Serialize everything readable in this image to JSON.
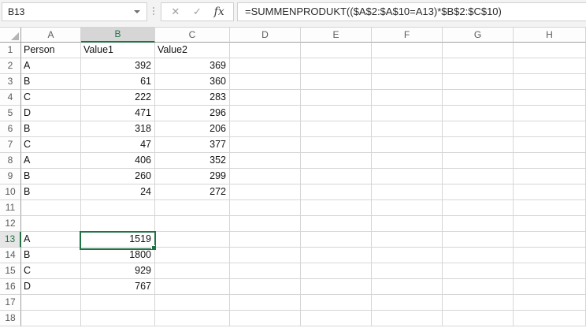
{
  "name_box": {
    "value": "B13"
  },
  "formula_bar": {
    "cancel_icon": "✕",
    "enter_icon": "✓",
    "insert_function_icon": "fx",
    "formula": "=SUMMENPRODUKT(($A$2:$A$10=A13)*$B$2:$C$10)"
  },
  "selection": {
    "active_cell": "B13",
    "column": "B",
    "row": 13,
    "accent_color": "#217346"
  },
  "sheet": {
    "column_headers": [
      "A",
      "B",
      "C",
      "D",
      "E",
      "F",
      "G",
      "H"
    ],
    "rows": [
      {
        "n": 1,
        "A": "Person",
        "B": "Value1",
        "C": "Value2"
      },
      {
        "n": 2,
        "A": "A",
        "B": 392,
        "C": 369
      },
      {
        "n": 3,
        "A": "B",
        "B": 61,
        "C": 360
      },
      {
        "n": 4,
        "A": "C",
        "B": 222,
        "C": 283
      },
      {
        "n": 5,
        "A": "D",
        "B": 471,
        "C": 296
      },
      {
        "n": 6,
        "A": "B",
        "B": 318,
        "C": 206
      },
      {
        "n": 7,
        "A": "C",
        "B": 47,
        "C": 377
      },
      {
        "n": 8,
        "A": "A",
        "B": 406,
        "C": 352
      },
      {
        "n": 9,
        "A": "B",
        "B": 260,
        "C": 299
      },
      {
        "n": 10,
        "A": "B",
        "B": 24,
        "C": 272
      },
      {
        "n": 11
      },
      {
        "n": 12
      },
      {
        "n": 13,
        "A": "A",
        "B": 1519
      },
      {
        "n": 14,
        "A": "B",
        "B": 1800
      },
      {
        "n": 15,
        "A": "C",
        "B": 929
      },
      {
        "n": 16,
        "A": "D",
        "B": 767
      },
      {
        "n": 17
      },
      {
        "n": 18
      }
    ]
  }
}
